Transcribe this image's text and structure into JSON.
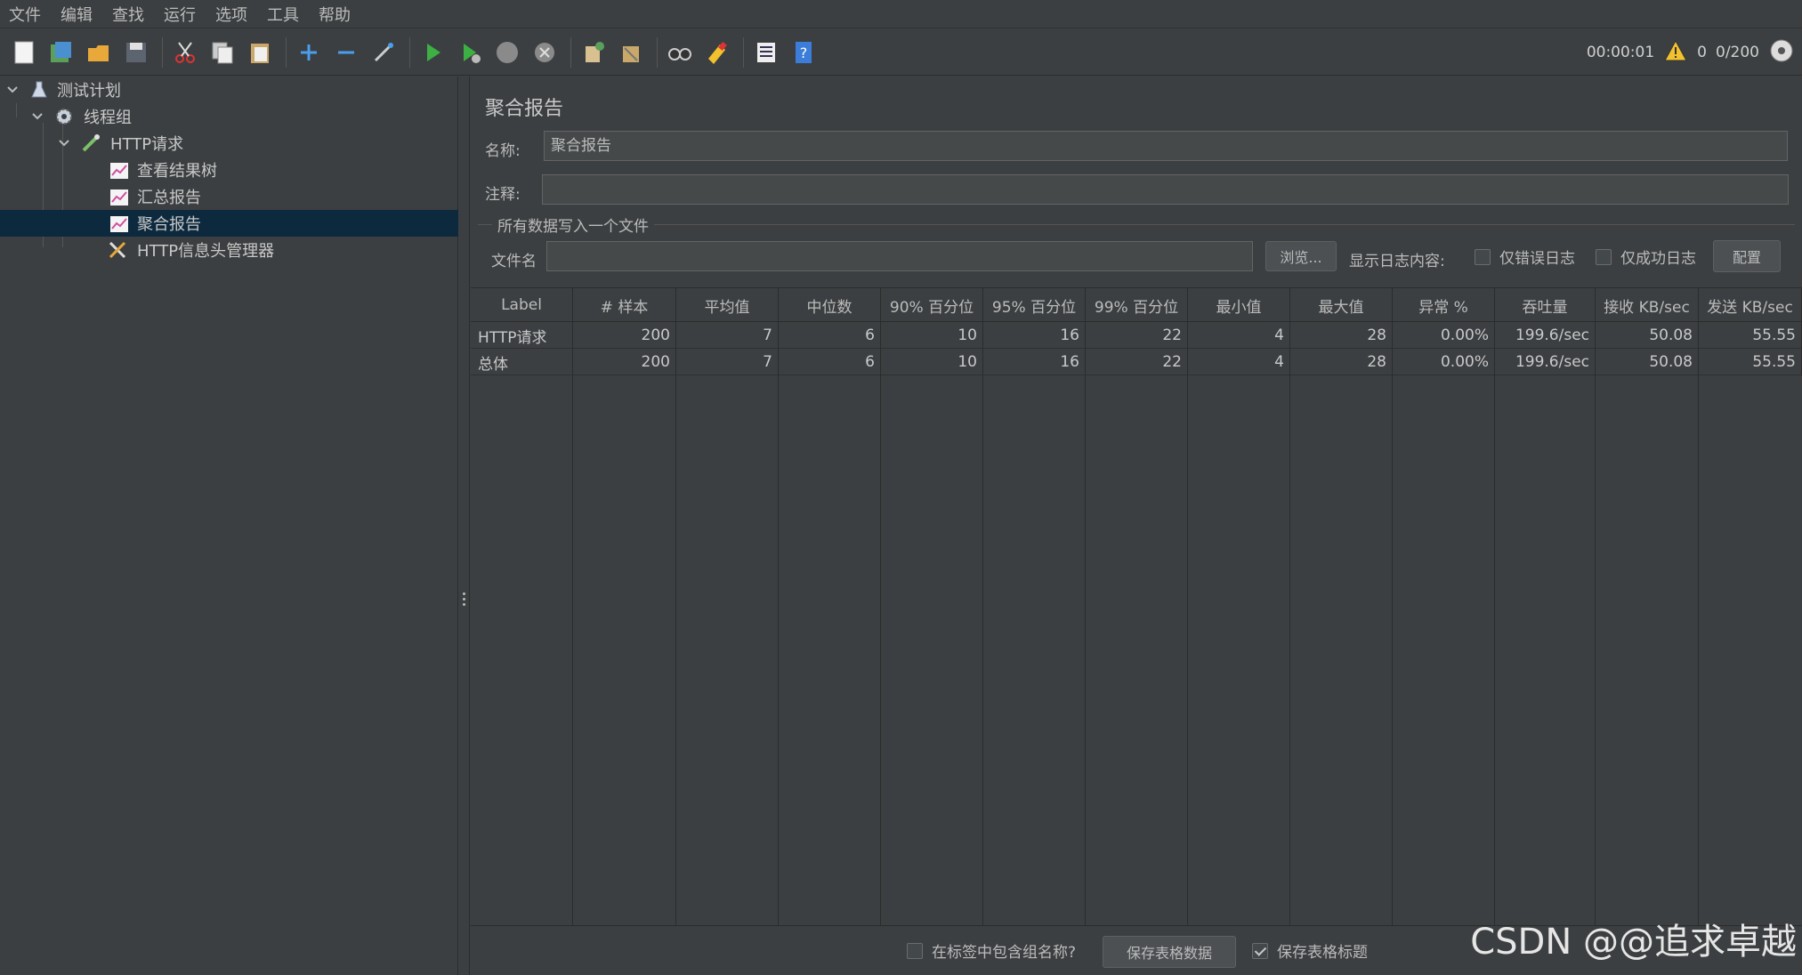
{
  "menu": [
    "文件",
    "编辑",
    "查找",
    "运行",
    "选项",
    "工具",
    "帮助"
  ],
  "toolbar": {
    "timer": "00:00:01",
    "warning_count": "0",
    "threads": "0/200"
  },
  "tree": {
    "items": [
      {
        "label": "测试计划",
        "icon": "flask-icon"
      },
      {
        "label": "线程组",
        "icon": "gear-icon"
      },
      {
        "label": "HTTP请求",
        "icon": "pipette-icon"
      },
      {
        "label": "查看结果树",
        "icon": "chart-icon"
      },
      {
        "label": "汇总报告",
        "icon": "chart-icon"
      },
      {
        "label": "聚合报告",
        "icon": "chart-icon"
      },
      {
        "label": "HTTP信息头管理器",
        "icon": "tools-icon"
      }
    ]
  },
  "panel": {
    "title": "聚合报告",
    "name_label": "名称:",
    "name_value": "聚合报告",
    "comment_label": "注释:",
    "comment_value": "",
    "file_group_title": "所有数据写入一个文件",
    "filename_label": "文件名",
    "filename_value": "",
    "browse_button": "浏览...",
    "log_label": "显示日志内容:",
    "errors_only": "仅错误日志",
    "success_only": "仅成功日志",
    "config_button": "配置"
  },
  "table": {
    "headers": [
      "Label",
      "# 样本",
      "平均值",
      "中位数",
      "90% 百分位",
      "95% 百分位",
      "99% 百分位",
      "最小值",
      "最大值",
      "异常 %",
      "吞吐量",
      "接收 KB/sec",
      "发送 KB/sec"
    ],
    "rows": [
      [
        "HTTP请求",
        "200",
        "7",
        "6",
        "10",
        "16",
        "22",
        "4",
        "28",
        "0.00%",
        "199.6/sec",
        "50.08",
        "55.55"
      ],
      [
        "总体",
        "200",
        "7",
        "6",
        "10",
        "16",
        "22",
        "4",
        "28",
        "0.00%",
        "199.6/sec",
        "50.08",
        "55.55"
      ]
    ]
  },
  "bottom": {
    "include_group": "在标签中包含组名称?",
    "save_table": "保存表格数据",
    "save_header": "保存表格标题",
    "save_header_checked": true
  },
  "watermark": "CSDN @@追求卓越"
}
